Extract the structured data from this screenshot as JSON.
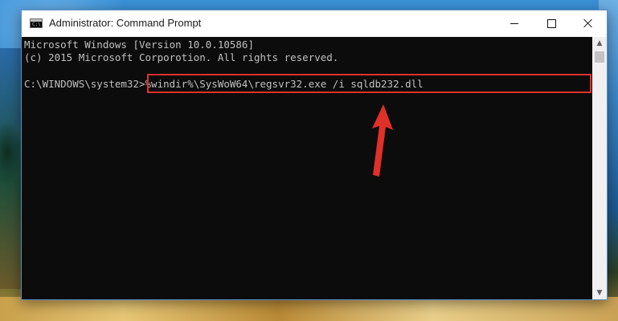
{
  "window": {
    "title": "Administrator: Command Prompt",
    "icon": "cmd-icon",
    "controls": {
      "minimize": "minimize-icon",
      "maximize": "maximize-icon",
      "close": "close-icon"
    }
  },
  "console": {
    "lines": [
      "Microsoft Windows [Version 10.0.10586]",
      "(c) 2015 Microsoft Corporotion. All rights reserved."
    ],
    "prompt": "C:\\WINDOWS\\system32>",
    "command": "%windir%\\SysWoW64\\regsvr32.exe /i sqldb232.dll"
  },
  "annotation": {
    "highlight_color": "#e0302a",
    "arrow_color": "#e0302a"
  },
  "colors": {
    "console_background": "#0c0c0c",
    "console_text": "#c0c0c0"
  }
}
